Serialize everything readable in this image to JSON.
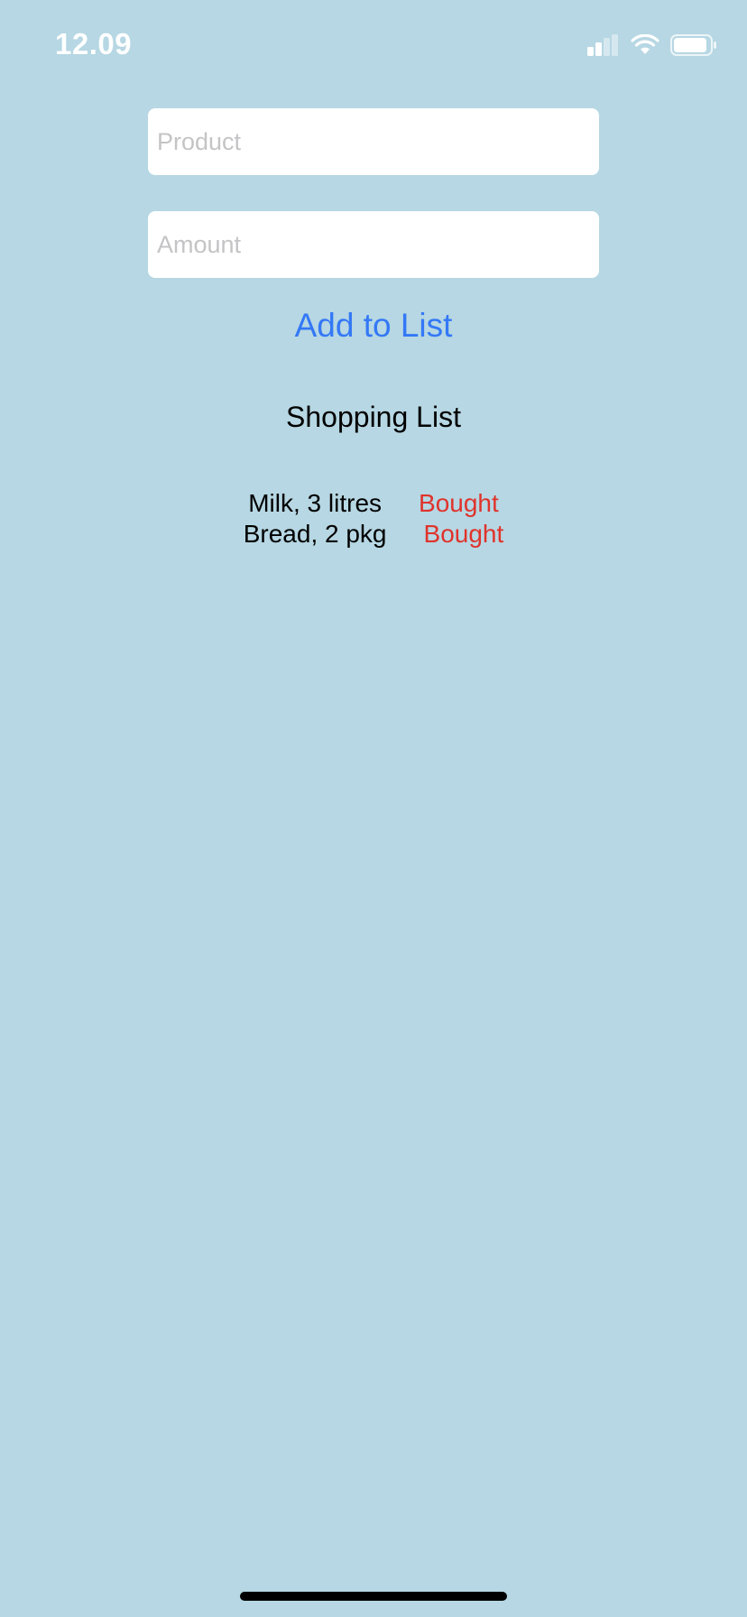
{
  "status_bar": {
    "time": "12.09",
    "icons": [
      "cellular-signal-icon",
      "wifi-icon",
      "battery-icon"
    ]
  },
  "form": {
    "product_placeholder": "Product",
    "product_value": "",
    "amount_placeholder": "Amount",
    "amount_value": "",
    "add_button_label": "Add to List"
  },
  "list": {
    "title": "Shopping List",
    "items": [
      {
        "text": "Milk, 3 litres",
        "action": "Bought"
      },
      {
        "text": "Bread, 2 pkg",
        "action": "Bought"
      }
    ]
  },
  "colors": {
    "background": "#b6d7e3",
    "accent": "#3478f6",
    "bought": "#e0332c"
  }
}
